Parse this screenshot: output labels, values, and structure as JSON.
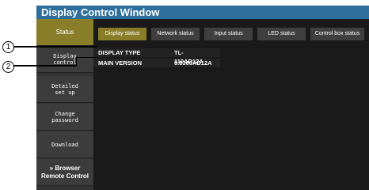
{
  "window": {
    "title": "Display Control Window"
  },
  "sidebar": {
    "items": [
      {
        "label": "Status"
      },
      {
        "label": "Display\ncontrol"
      },
      {
        "label": "Detailed\nset up"
      },
      {
        "label": "Change\npassword"
      },
      {
        "label": "Download"
      },
      {
        "label": "» Browser\nRemote Control"
      }
    ]
  },
  "tabs": [
    {
      "label": "Display status"
    },
    {
      "label": "Network status"
    },
    {
      "label": "Input status"
    },
    {
      "label": "LED status"
    },
    {
      "label": "Control box status"
    }
  ],
  "status": {
    "rows": [
      {
        "label": "DISPLAY TYPE",
        "value": "TL-110AD12A"
      },
      {
        "label": "MAIN VERSION",
        "value": "0.8300AD12A"
      }
    ]
  },
  "callouts": [
    "1",
    "2"
  ],
  "colors": {
    "titlebar": "#2e6f9e",
    "active": "#8a7d2a",
    "background": "#1a1a1a"
  }
}
